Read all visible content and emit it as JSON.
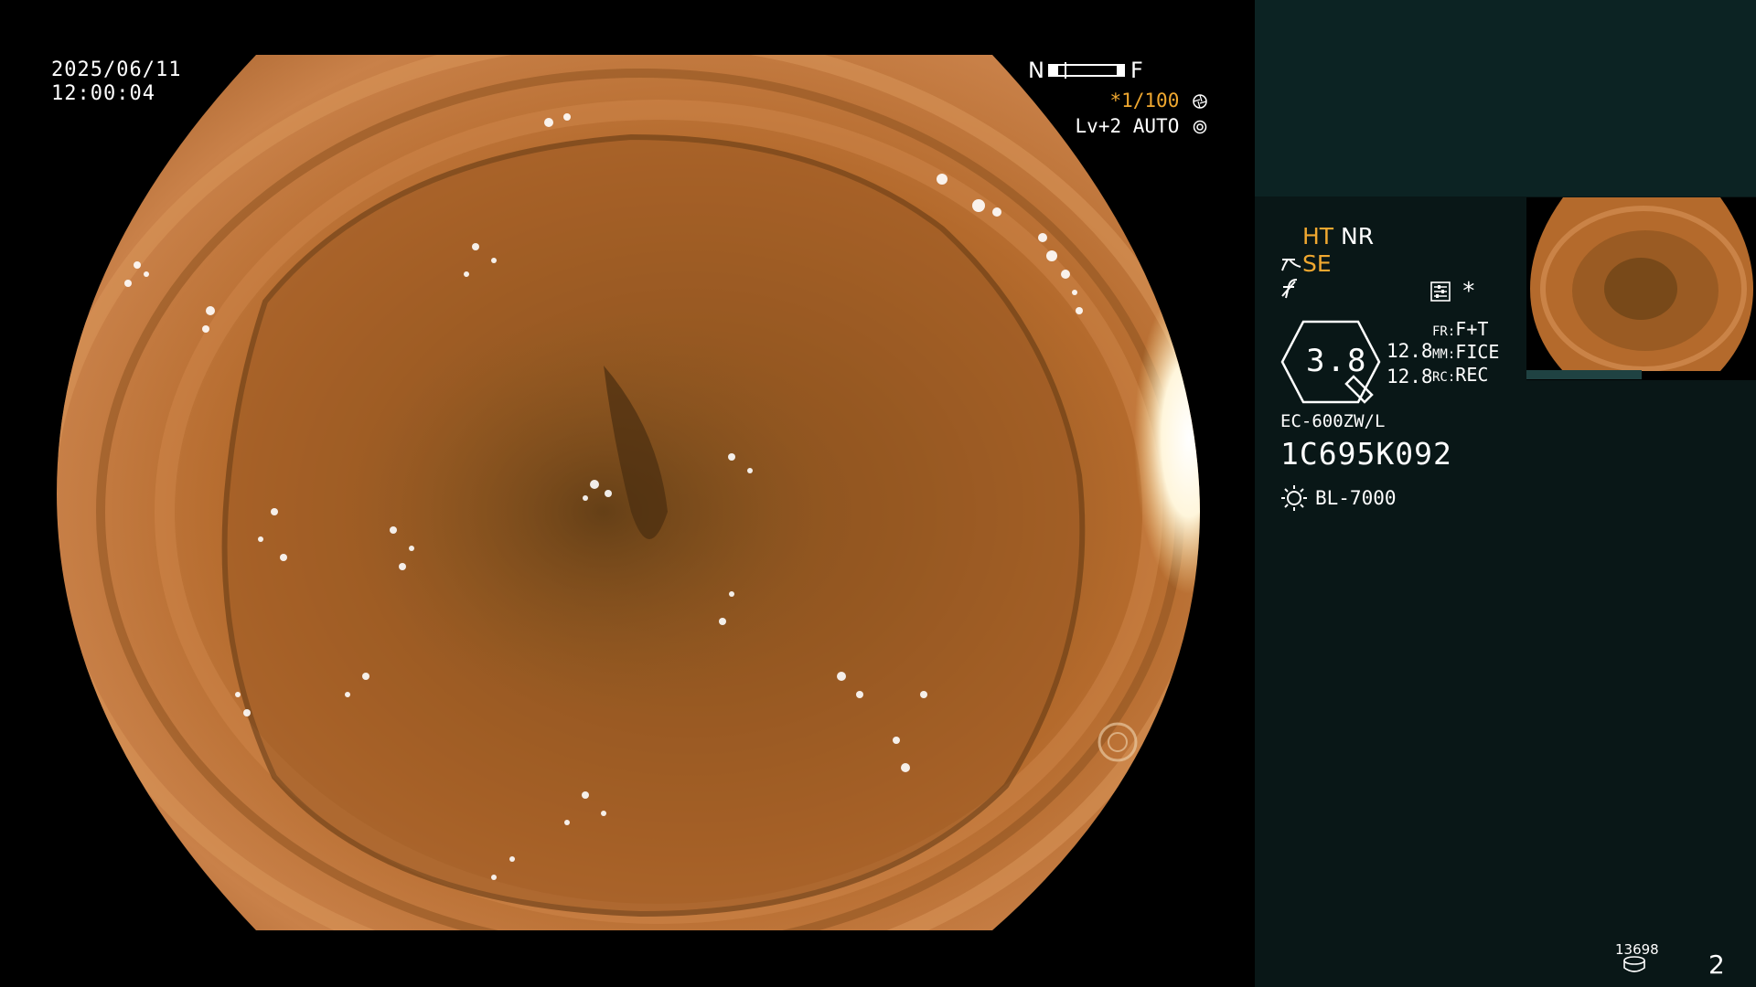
{
  "overlay": {
    "date": "2025/06/11",
    "time": "12:00:04",
    "gauge_near": "N",
    "gauge_far": "F",
    "shutter_prefix": "*",
    "shutter_value": "1/100",
    "level": "Lv+2",
    "iris_mode": "AUTO"
  },
  "panel": {
    "ht": "HT",
    "nr": "NR",
    "se": "SE",
    "asterisk": "*",
    "zoom_value": "3.8",
    "value_a": "12.8",
    "value_b": "12.8",
    "fr_label": "FR:",
    "fr_value": "F+T",
    "mm_label": "MM:",
    "mm_value": "FICE",
    "rc_label": "RC:",
    "rc_value": "REC",
    "scope_model": "EC-600ZW/L",
    "scope_serial": "1C695K092",
    "light_source": "BL-7000",
    "storage_count": "13698",
    "page_number": "2"
  },
  "colors": {
    "accent": "#f0a830",
    "panel_bg": "#091717",
    "panel_top_bg": "#0c2323",
    "tissue": "#b86a2c"
  },
  "icons": {
    "shutter": "aperture-icon",
    "iris": "gear-icon",
    "structure": "structure-enhance-icon",
    "freq": "f-slash-icon",
    "settings": "menu-settings-icon",
    "light": "sun-icon",
    "storage": "disk-stack-icon"
  }
}
